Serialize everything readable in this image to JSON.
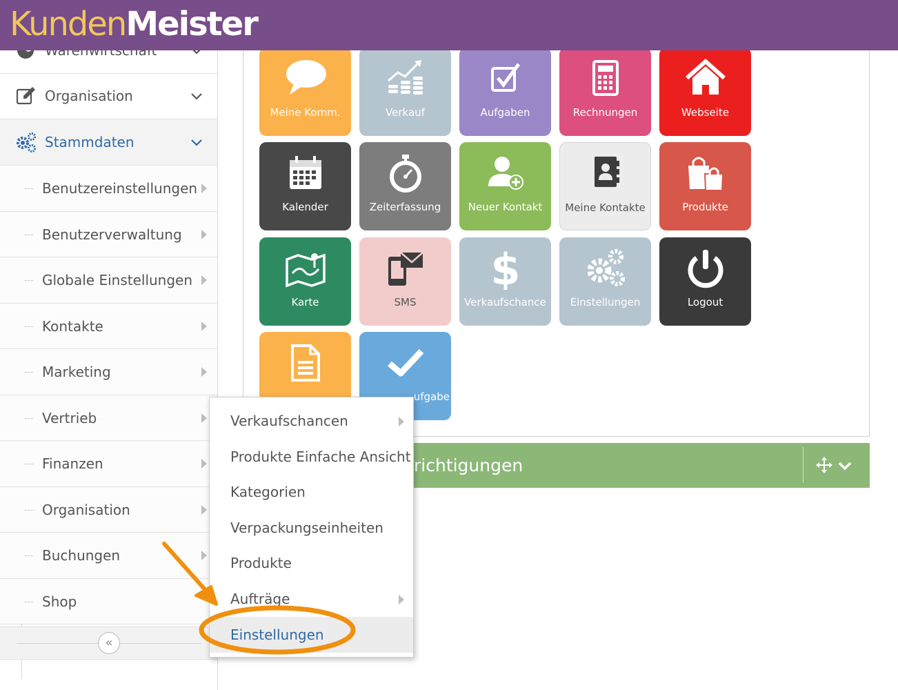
{
  "header": {
    "logo_part1": "Kunden",
    "logo_part2": "Meister"
  },
  "colors": {
    "header_bg": "#774d8a",
    "logo_accent": "#f1c75a",
    "active_text": "#2f6aa5",
    "annotation": "#f0900f",
    "section_bar": "#8cb877"
  },
  "sidebar": {
    "partial_item": {
      "label": "Warenwirtschaft",
      "icon": "globe-icon"
    },
    "top_items": [
      {
        "label": "Organisation",
        "icon": "edit-icon"
      },
      {
        "label": "Stammdaten",
        "icon": "gears-icon"
      }
    ],
    "sub_items": [
      {
        "label": "Benutzereinstellungen"
      },
      {
        "label": "Benutzerverwaltung"
      },
      {
        "label": "Globale Einstellungen"
      },
      {
        "label": "Kontakte"
      },
      {
        "label": "Marketing"
      },
      {
        "label": "Vertrieb"
      },
      {
        "label": "Finanzen"
      },
      {
        "label": "Organisation"
      },
      {
        "label": "Buchungen"
      },
      {
        "label": "Shop"
      }
    ],
    "collapse_label": "«"
  },
  "tiles": [
    {
      "label": "Meine Komm.",
      "icon": "speech-bubble-icon",
      "color": "#fbb24b"
    },
    {
      "label": "Verkauf",
      "icon": "coins-chart-icon",
      "color": "#b5c5cf"
    },
    {
      "label": "Aufgaben",
      "icon": "checkbox-icon",
      "color": "#9a87c7"
    },
    {
      "label": "Rechnungen",
      "icon": "calculator-icon",
      "color": "#dc4f7f"
    },
    {
      "label": "Webseite",
      "icon": "home-icon",
      "color": "#ec1f1f"
    },
    {
      "label": "Kalender",
      "icon": "calendar-icon",
      "color": "#484848"
    },
    {
      "label": "Zeiterfassung",
      "icon": "stopwatch-icon",
      "color": "#7d7d7d"
    },
    {
      "label": "Neuer Kontakt",
      "icon": "add-user-icon",
      "color": "#8cbb59"
    },
    {
      "label": "Meine Kontakte",
      "icon": "address-book-icon",
      "color": "#ececec"
    },
    {
      "label": "Produkte",
      "icon": "shopping-bags-icon",
      "color": "#d7574a"
    },
    {
      "label": "Karte",
      "icon": "map-icon",
      "color": "#2e8b61"
    },
    {
      "label": "SMS",
      "icon": "phone-message-icon",
      "color": "#f2cccb"
    },
    {
      "label": "Verkaufschance",
      "icon": "dollar-icon",
      "color": "#b5c5cf"
    },
    {
      "label": "Einstellungen",
      "icon": "gears-icon",
      "color": "#b5c5cf"
    },
    {
      "label": "Logout",
      "icon": "power-icon",
      "color": "#3a3a3a"
    },
    {
      "label": "",
      "icon": "document-icon",
      "color": "#fbb24b"
    },
    {
      "label": "ufgabe",
      "icon": "checkmark-icon",
      "color": "#6aa9dc"
    }
  ],
  "section_bar": {
    "title": "richtigungen",
    "icons": [
      "move-icon",
      "chevron-down-icon"
    ]
  },
  "dropdown": {
    "items": [
      {
        "label": "Verkaufschancen"
      },
      {
        "label": "Produkte Einfache Ansicht"
      },
      {
        "label": "Kategorien"
      },
      {
        "label": "Verpackungseinheiten"
      },
      {
        "label": "Produkte"
      },
      {
        "label": "Aufträge"
      },
      {
        "label": "Einstellungen"
      }
    ]
  }
}
